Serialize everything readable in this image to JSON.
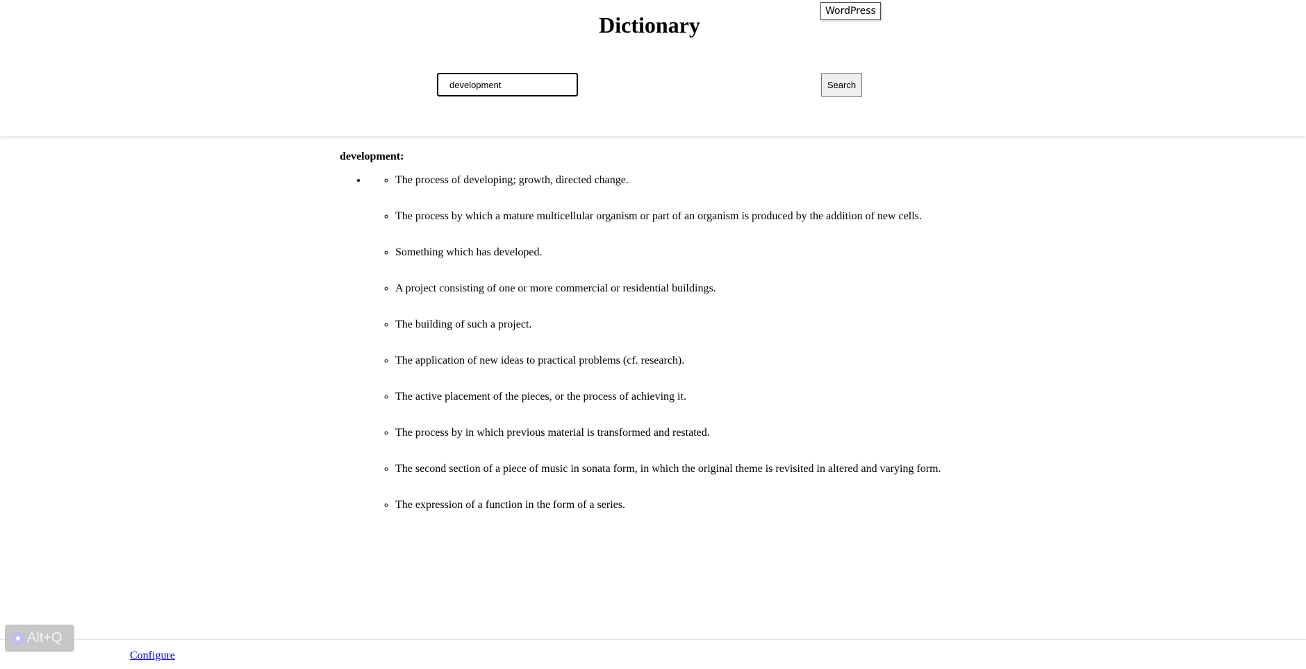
{
  "header": {
    "title": "Dictionary",
    "tooltip": "WordPress",
    "search_value": "development",
    "search_button": "Search"
  },
  "results": {
    "word": "development:",
    "definitions": [
      "The process of developing; growth, directed change.",
      "The process by which a mature multicellular organism or part of an organism is produced by the addition of new cells.",
      "Something which has developed.",
      "A project consisting of one or more commercial or residential buildings.",
      "The building of such a project.",
      "The application of new ideas to practical problems (cf. research).",
      "The active placement of the pieces, or the process of achieving it.",
      "The process by in which previous material is transformed and restated.",
      "The second section of a piece of music in sonata form, in which the original theme is revisited in altered and varying form.",
      "The expression of a function in the form of a series."
    ]
  },
  "footer": {
    "configure_label": "Configure"
  },
  "overlay": {
    "shortcut_label": "Alt+Q"
  }
}
